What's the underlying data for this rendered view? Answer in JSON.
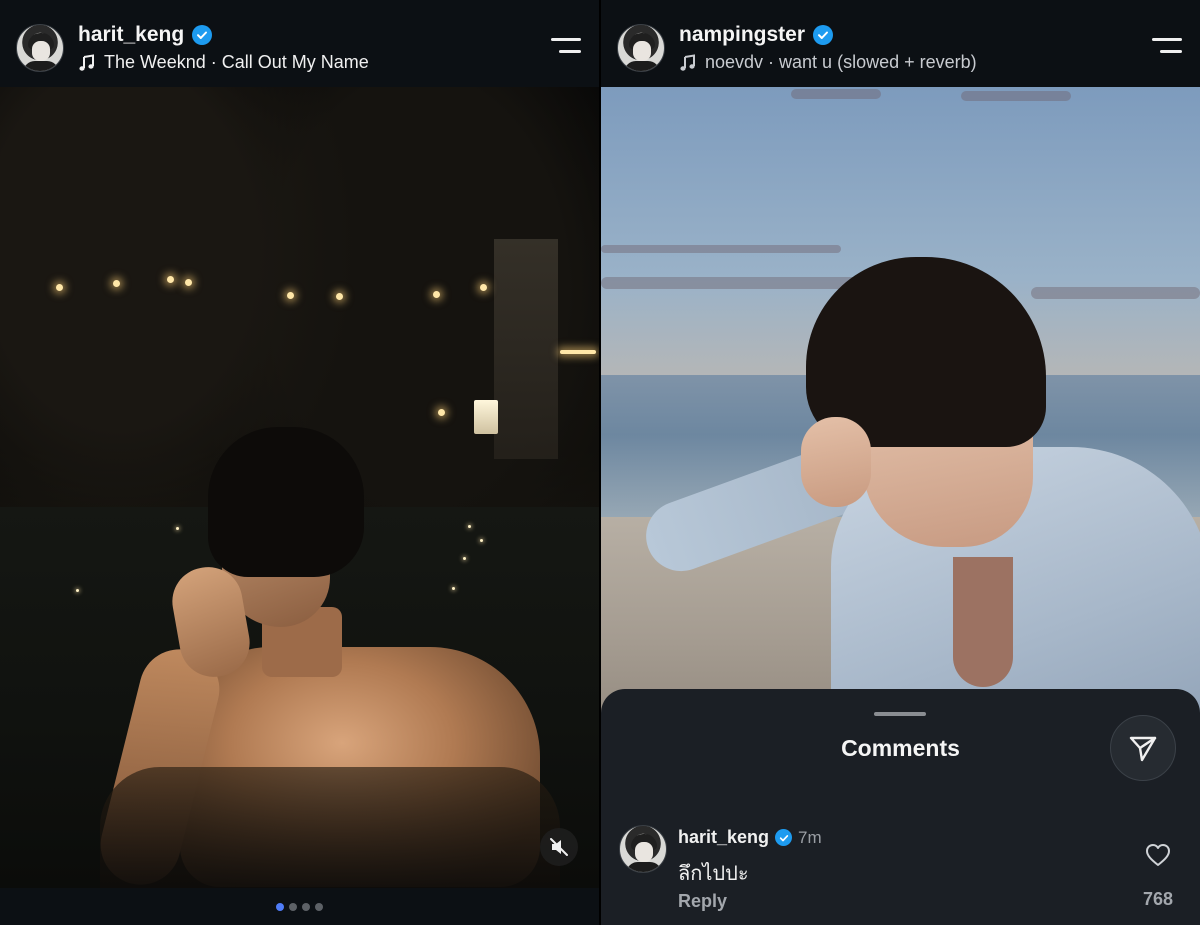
{
  "left_post": {
    "username": "harit_keng",
    "verified": true,
    "music_icon": "music-note-icon",
    "music": "The Weeknd · Call Out My Name",
    "menu_icon": "menu-icon",
    "media_control": "mute-icon",
    "carousel": {
      "total": 4,
      "current": 1,
      "active_color": "#4f7cf7"
    }
  },
  "right_post": {
    "username": "nampingster",
    "verified": true,
    "music_icon": "music-note-icon",
    "music": "noevdv · want u (slowed + reverb)",
    "menu_icon": "menu-icon"
  },
  "comments": {
    "title": "Comments",
    "share_icon": "send-icon",
    "items": [
      {
        "username": "harit_keng",
        "verified": true,
        "time": "7m",
        "text": "ลึกไปปะ",
        "reply_label": "Reply",
        "likes": "768",
        "like_icon": "heart-icon"
      }
    ]
  },
  "colors": {
    "background": "#0c1014",
    "sheet": "#1b1f25",
    "verified": "#1d9bf0"
  }
}
